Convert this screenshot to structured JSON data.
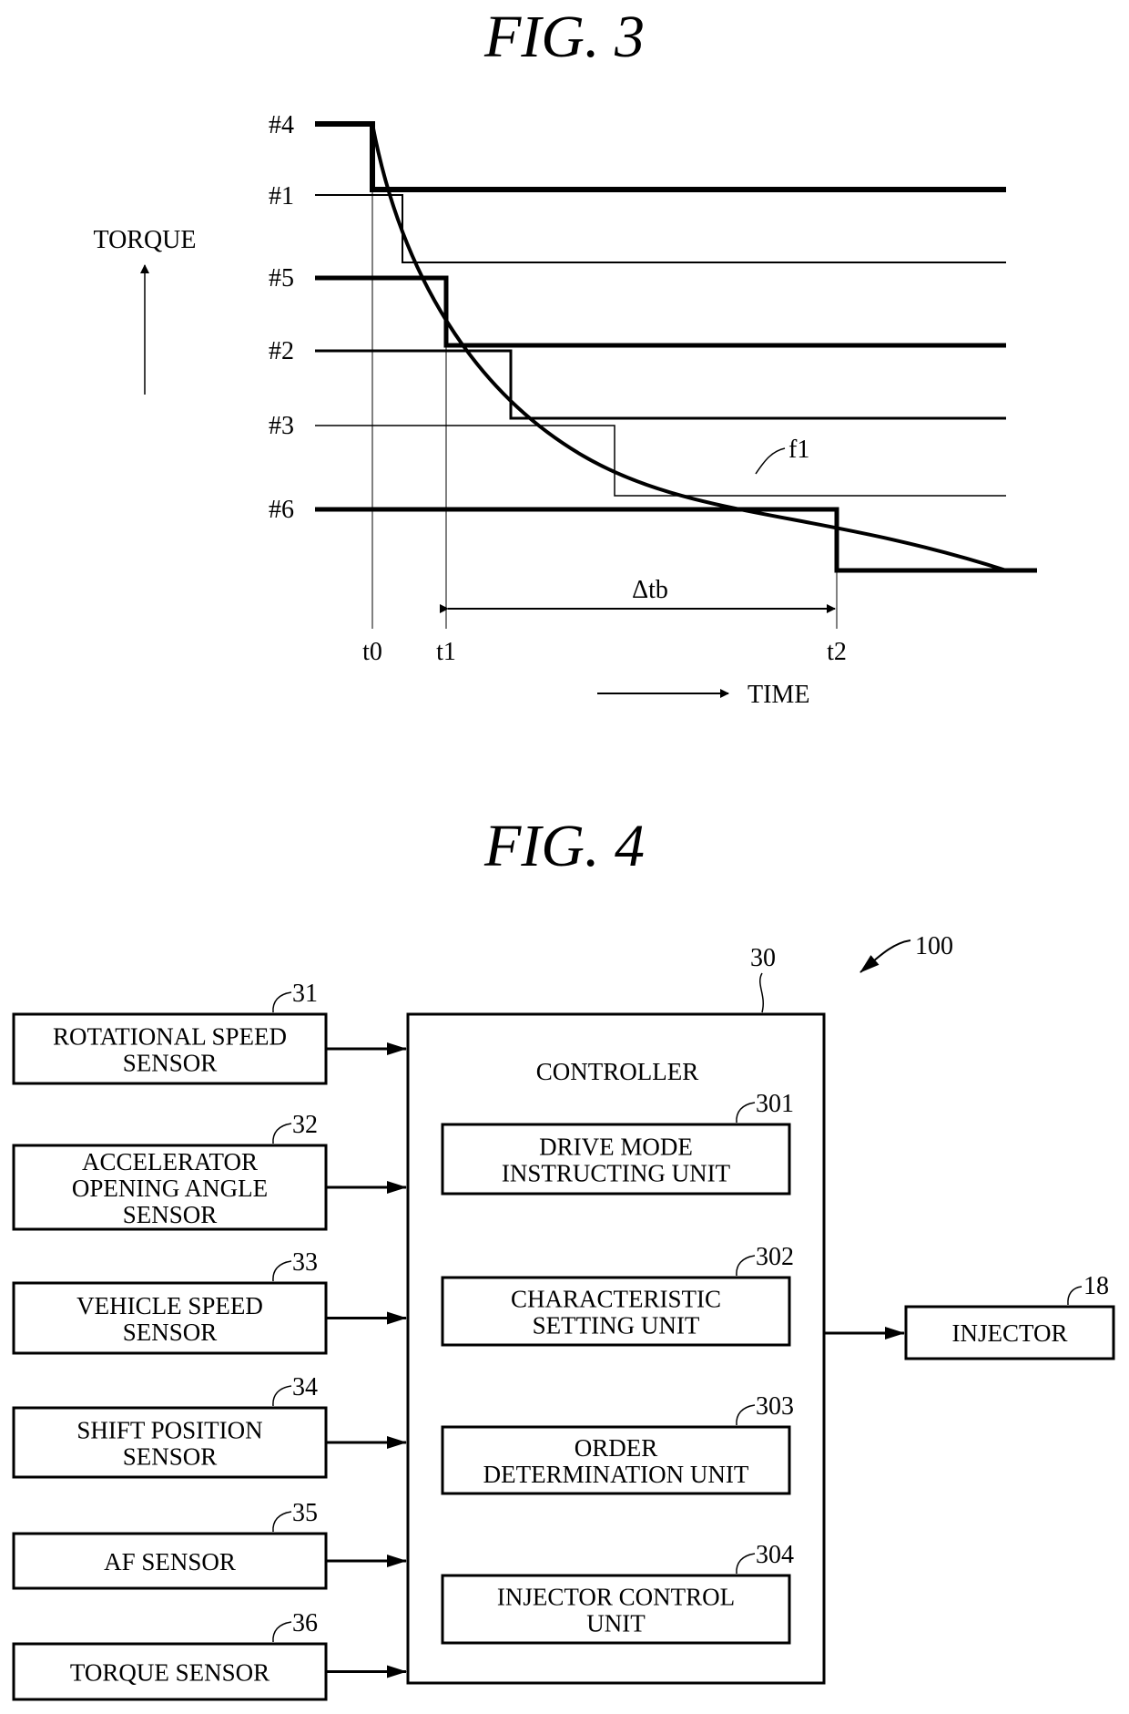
{
  "fig3": {
    "title": "FIG. 3",
    "y_axis_label": "TORQUE",
    "x_axis_label": "TIME",
    "curve_label": "f1",
    "interval_label": "Δtb",
    "time_labels": [
      "t0",
      "t1",
      "t2"
    ],
    "cylinder_labels": [
      "#4",
      "#1",
      "#5",
      "#2",
      "#3",
      "#6"
    ]
  },
  "chart_data": {
    "type": "line",
    "title": "FIG. 3",
    "xlabel": "TIME",
    "ylabel": "TORQUE",
    "x_ticks": [
      "t0",
      "t1",
      "t2"
    ],
    "y_ticks": [
      "#4",
      "#1",
      "#5",
      "#2",
      "#3",
      "#6"
    ],
    "annotations": [
      "f1",
      "Δtb (t1 to t2)"
    ],
    "series": [
      {
        "name": "f1",
        "description": "torque decreasing curve from #4 level at t0 to below #6 level"
      },
      {
        "name": "#4",
        "level_order": 1,
        "drops_at": "t0"
      },
      {
        "name": "#1",
        "level_order": 2
      },
      {
        "name": "#5",
        "level_order": 3,
        "drops_at": "t1"
      },
      {
        "name": "#2",
        "level_order": 4
      },
      {
        "name": "#3",
        "level_order": 5
      },
      {
        "name": "#6",
        "level_order": 6,
        "drops_at": "t2"
      }
    ]
  },
  "fig4": {
    "title": "FIG. 4",
    "system_ref": "100",
    "controller": {
      "ref": "30",
      "label": "CONTROLLER"
    },
    "sensors": [
      {
        "ref": "31",
        "lines": [
          "ROTATIONAL SPEED",
          "SENSOR"
        ]
      },
      {
        "ref": "32",
        "lines": [
          "ACCELERATOR",
          "OPENING ANGLE",
          "SENSOR"
        ]
      },
      {
        "ref": "33",
        "lines": [
          "VEHICLE SPEED",
          "SENSOR"
        ]
      },
      {
        "ref": "34",
        "lines": [
          "SHIFT POSITION",
          "SENSOR"
        ]
      },
      {
        "ref": "35",
        "lines": [
          "AF SENSOR"
        ]
      },
      {
        "ref": "36",
        "lines": [
          "TORQUE SENSOR"
        ]
      }
    ],
    "units": [
      {
        "ref": "301",
        "lines": [
          "DRIVE MODE",
          "INSTRUCTING UNIT"
        ]
      },
      {
        "ref": "302",
        "lines": [
          "CHARACTERISTIC",
          "SETTING UNIT"
        ]
      },
      {
        "ref": "303",
        "lines": [
          "ORDER",
          "DETERMINATION UNIT"
        ]
      },
      {
        "ref": "304",
        "lines": [
          "INJECTOR CONTROL",
          "UNIT"
        ]
      }
    ],
    "output": {
      "ref": "18",
      "label": "INJECTOR"
    }
  }
}
